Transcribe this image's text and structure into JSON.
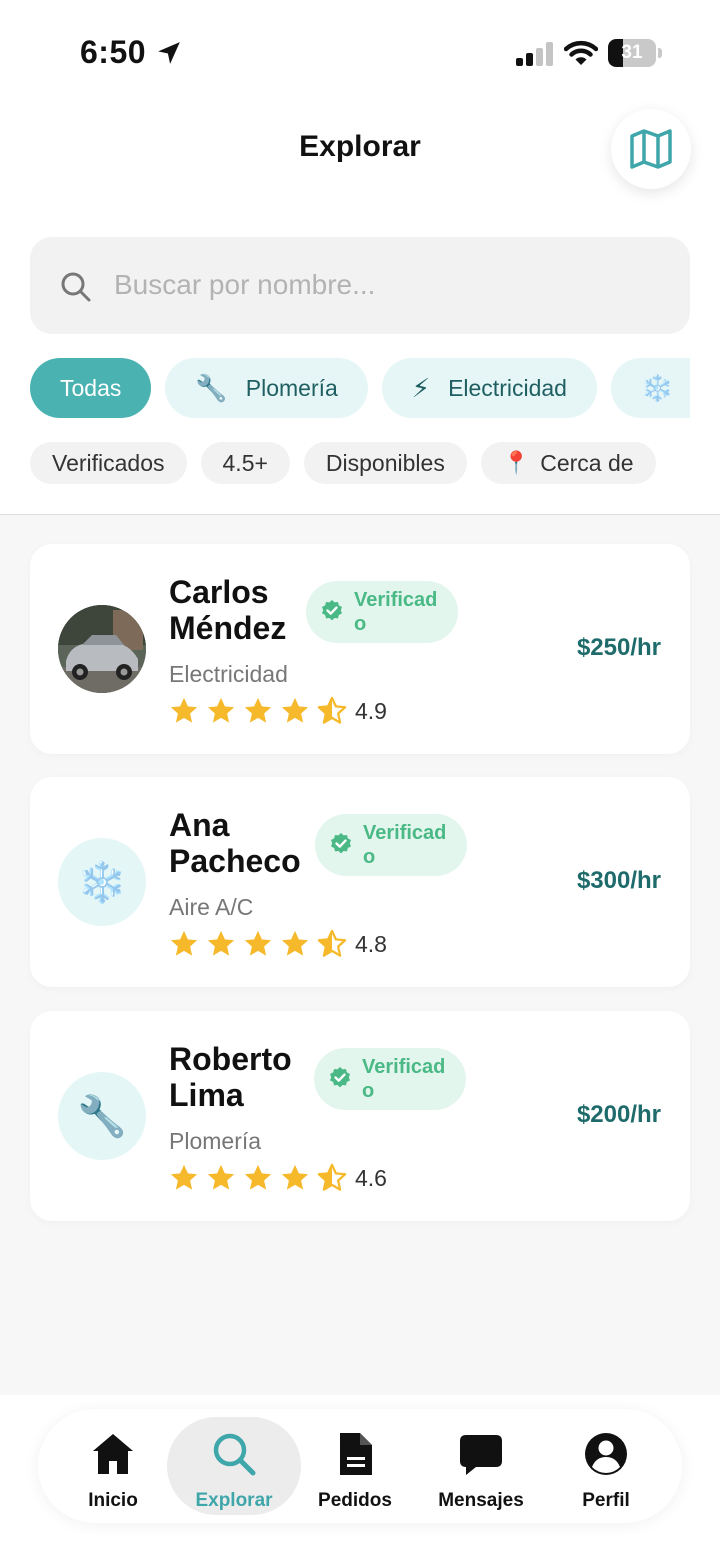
{
  "status_bar": {
    "time": "6:50",
    "battery_level": "31"
  },
  "header": {
    "title": "Explorar",
    "map_button_icon": "map-icon"
  },
  "search": {
    "placeholder": "Buscar por nombre..."
  },
  "categories": [
    {
      "label": "Todas",
      "emoji": "",
      "active": true
    },
    {
      "label": "Plomería",
      "emoji": "🔧",
      "active": false
    },
    {
      "label": "Electricidad",
      "emoji": "⚡",
      "active": false
    },
    {
      "label": "",
      "emoji": "❄️",
      "active": false
    }
  ],
  "filters": [
    {
      "label": "Verificados",
      "emoji": ""
    },
    {
      "label": "4.5+",
      "emoji": ""
    },
    {
      "label": "Disponibles",
      "emoji": ""
    },
    {
      "label": "Cerca de",
      "emoji": "📍"
    }
  ],
  "professionals": [
    {
      "name": "Carlos Méndez",
      "badge_line1": "Verificad",
      "badge_line2": "o",
      "category": "Electricidad",
      "rating": "4.9",
      "price": "$250/hr",
      "avatar": "car-photo"
    },
    {
      "name": "Ana Pacheco",
      "badge_line1": "Verificad",
      "badge_line2": "o",
      "category": "Aire A/C",
      "rating": "4.8",
      "price": "$300/hr",
      "avatar": "❄️"
    },
    {
      "name": "Roberto Lima",
      "badge_line1": "Verificad",
      "badge_line2": "o",
      "category": "Plomería",
      "rating": "4.6",
      "price": "$200/hr",
      "avatar": "🔧"
    }
  ],
  "tab_bar": [
    {
      "label": "Inicio",
      "icon": "home-icon",
      "active": false
    },
    {
      "label": "Explorar",
      "icon": "search-icon",
      "active": true
    },
    {
      "label": "Pedidos",
      "icon": "document-icon",
      "active": false
    },
    {
      "label": "Mensajes",
      "icon": "chat-bubble-icon",
      "active": false
    },
    {
      "label": "Perfil",
      "icon": "profile-icon",
      "active": false
    }
  ],
  "colors": {
    "accent": "#4bb2b2",
    "chip_bg": "#e6f6f6",
    "verified": "#4ab986",
    "star": "#f6b92b",
    "price": "#1f6b6b"
  }
}
